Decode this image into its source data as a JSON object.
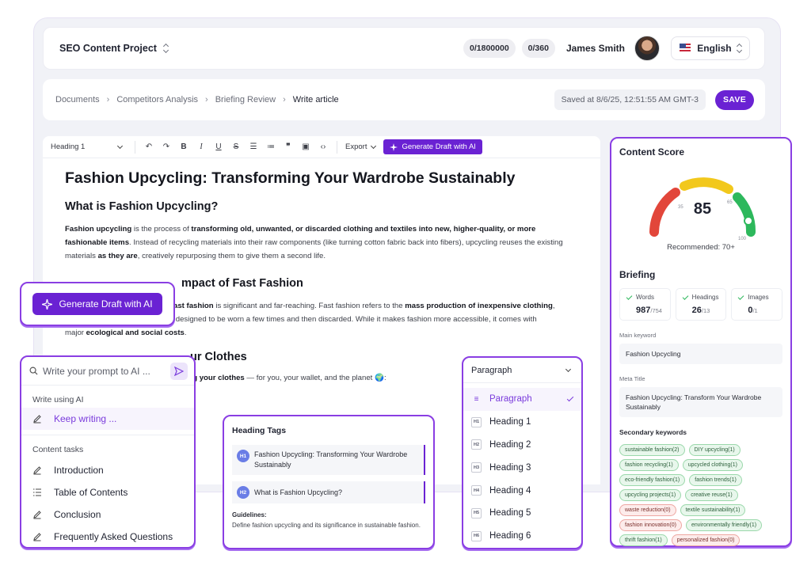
{
  "topbar": {
    "project_title": "SEO Content Project",
    "count_1": "0/1800000",
    "count_2": "0/360",
    "user_name": "James Smith",
    "language": "English"
  },
  "breadcrumb": {
    "items": [
      "Documents",
      "Competitors Analysis",
      "Briefing Review",
      "Write article"
    ],
    "separator": "›",
    "saved_text": "Saved at 8/6/25, 12:51:55 AM GMT-3",
    "save_label": "SAVE"
  },
  "toolbar": {
    "block_style": "Heading 1",
    "export_label": "Export",
    "generate_label": "Generate Draft with AI"
  },
  "document": {
    "title": "Fashion Upcycling: Transforming Your Wardrobe Sustainably",
    "h2_1": "What is Fashion Upcycling?",
    "p1_a": "Fashion upcycling",
    "p1_b": " is the process of ",
    "p1_c": "transforming old, unwanted, or discarded clothing and textiles into new, higher-quality, or more fashionable items",
    "p1_d": ". Instead of recycling materials into their raw components (like turning cotton fabric back into fibers), upcycling reuses the existing materials ",
    "p1_e": "as they are",
    "p1_f": ", creatively repurposing them to give them a second life.",
    "h2_2_partial": "mpact of Fast Fashion",
    "p2_a": "ast fashion",
    "p2_b": " is significant and far-reaching. Fast fashion refers to the ",
    "p2_c": "mass production of inexpensive clothing",
    "p2_d": ",",
    "p2_line2": "often based on the latest trends, designed to be worn a few times and then discarded. While it makes fashion more accessible, it comes with",
    "p2_e": "major ",
    "p2_f": "ecological and social costs",
    "p2_g": ".",
    "h2_3_partial": "ur Clothes",
    "p3_a": "ling your clothes",
    "p3_b": " — for you, your wallet, and the planet 🌍:"
  },
  "content_score": {
    "title": "Content Score",
    "score": "85",
    "recommended": "Recommended: 70+",
    "gauge_ticks": [
      "35",
      "65",
      "100"
    ]
  },
  "briefing": {
    "title": "Briefing",
    "metrics": [
      {
        "label": "Words",
        "value": "987",
        "target": "/754"
      },
      {
        "label": "Headings",
        "value": "26",
        "target": "/13"
      },
      {
        "label": "Images",
        "value": "0",
        "target": "/1"
      }
    ],
    "main_keyword_label": "Main keyword",
    "main_keyword": "Fashion Upcycling",
    "meta_title_label": "Meta Title",
    "meta_title": "Fashion Upcycling: Transform Your Wardrobe Sustainably",
    "secondary_title": "Secondary keywords",
    "keywords": [
      {
        "text": "sustainable fashion(2)",
        "status": "green"
      },
      {
        "text": "DIY upcycling(1)",
        "status": "green"
      },
      {
        "text": "fashion recycling(1)",
        "status": "green"
      },
      {
        "text": "upcycled clothing(1)",
        "status": "green"
      },
      {
        "text": "eco-friendly fashion(1)",
        "status": "green"
      },
      {
        "text": "fashion trends(1)",
        "status": "green"
      },
      {
        "text": "upcycling projects(1)",
        "status": "green"
      },
      {
        "text": "creative reuse(1)",
        "status": "green"
      },
      {
        "text": "waste reduction(0)",
        "status": "red"
      },
      {
        "text": "textile sustainability(1)",
        "status": "green"
      },
      {
        "text": "fashion innovation(0)",
        "status": "red"
      },
      {
        "text": "environmentally friendly(1)",
        "status": "green"
      },
      {
        "text": "thrift fashion(1)",
        "status": "green"
      },
      {
        "text": "personalized fashion(0)",
        "status": "red"
      }
    ]
  },
  "generate_popup": {
    "label": "Generate Draft with AI"
  },
  "prompt_panel": {
    "placeholder": "Write your prompt to AI ...",
    "write_using_label": "Write using AI",
    "keep_writing": "Keep writing ...",
    "content_tasks_label": "Content tasks",
    "tasks": [
      "Introduction",
      "Table of Contents",
      "Conclusion",
      "Frequently Asked Questions"
    ]
  },
  "heading_tags": {
    "title": "Heading Tags",
    "items": [
      {
        "badge": "H1",
        "text": "Fashion Upcycling: Transforming Your Wardrobe Sustainably"
      },
      {
        "badge": "H2",
        "text": "What is Fashion Upcycling?"
      }
    ],
    "guidelines_label": "Guidelines:",
    "guidelines_text": "Define fashion upcycling and its significance in sustainable fashion."
  },
  "paragraph_menu": {
    "selected": "Paragraph",
    "options": [
      {
        "badge": "≡",
        "label": "Paragraph"
      },
      {
        "badge": "H1",
        "label": "Heading 1"
      },
      {
        "badge": "H2",
        "label": "Heading 2"
      },
      {
        "badge": "H3",
        "label": "Heading 3"
      },
      {
        "badge": "H4",
        "label": "Heading 4"
      },
      {
        "badge": "H5",
        "label": "Heading 5"
      },
      {
        "badge": "H6",
        "label": "Heading 6"
      }
    ]
  },
  "colors": {
    "accent": "#6a22d3",
    "panel_border": "#8a3ee3",
    "gauge_red": "#e2463a",
    "gauge_yellow": "#f2c81c",
    "gauge_green": "#2db85c"
  }
}
